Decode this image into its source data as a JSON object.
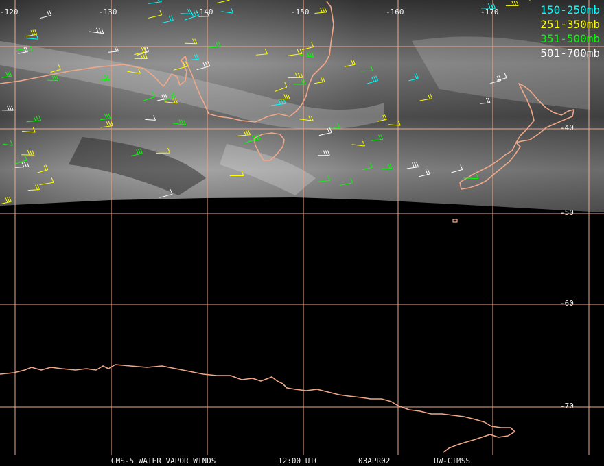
{
  "legend": [
    {
      "label": "150-250mb",
      "color": "#00ffff"
    },
    {
      "label": "251-350mb",
      "color": "#ffff00"
    },
    {
      "label": "351-500mb",
      "color": "#00ff00"
    },
    {
      "label": "501-700mb",
      "color": "#ffffff"
    }
  ],
  "lon_labels": [
    "-120",
    "-130",
    "-140",
    "-150",
    "-160",
    "-170"
  ],
  "lat_labels": [
    "-40",
    "-50",
    "-60",
    "-70"
  ],
  "footer": {
    "product": "GMS-5 WATER VAPOR WINDS",
    "time": "12:00 UTC",
    "date": "03APR02",
    "source": "UW-CIMSS"
  },
  "colors": {
    "grid": "#f0a888",
    "coast": "#f0a888",
    "background": "#000000"
  }
}
